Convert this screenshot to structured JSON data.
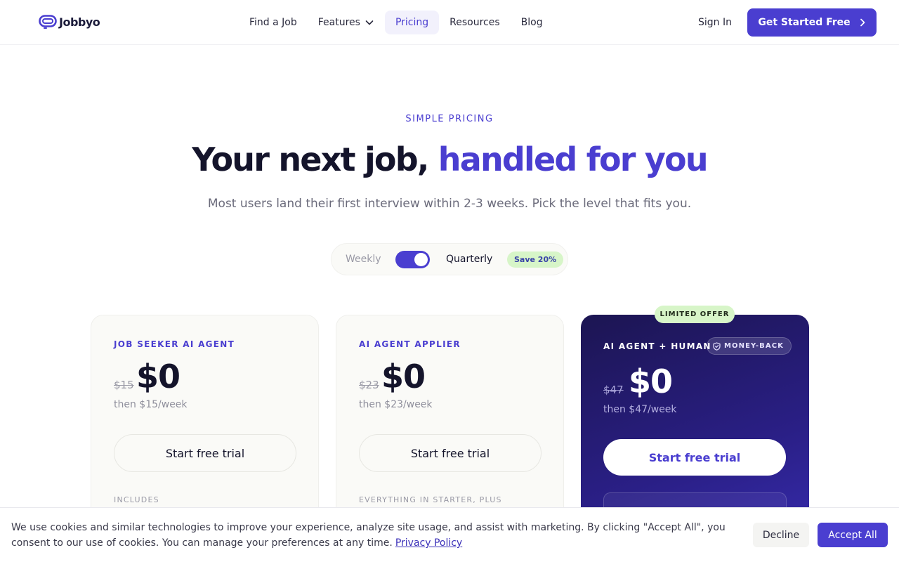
{
  "brand": {
    "name": "Jobbyo",
    "accent": "#4a3ed0"
  },
  "nav": {
    "items": [
      {
        "label": "Find a Job"
      },
      {
        "label": "Features"
      },
      {
        "label": "Pricing"
      },
      {
        "label": "Resources"
      },
      {
        "label": "Blog"
      }
    ],
    "active": "Pricing",
    "sign_in": "Sign In",
    "cta": "Get Started Free"
  },
  "hero": {
    "eyebrow": "SIMPLE PRICING",
    "title_main": "Your next job,",
    "title_accent": "handled for you",
    "subtitle": "Most users land their first interview within 2-3 weeks. Pick the level that fits you."
  },
  "billing": {
    "weekly": "Weekly",
    "quarterly": "Quarterly",
    "badge": "Save 20%",
    "selected": "Quarterly"
  },
  "plans": [
    {
      "title": "JOB SEEKER AI AGENT",
      "old_price": "$15",
      "price": "$0",
      "then": "then $15/week",
      "button": "Start free trial",
      "includes": "INCLUDES"
    },
    {
      "title": "AI AGENT APPLIER",
      "old_price": "$23",
      "price": "$0",
      "then": "then $23/week",
      "button": "Start free trial",
      "includes": "EVERYTHING IN STARTER, PLUS"
    },
    {
      "title": "AI AGENT + HUMAN",
      "badge": "MONEY-BACK",
      "ribbon": "LIMITED OFFER",
      "old_price": "$47",
      "price": "$0",
      "then": "then $47/week",
      "button": "Start free trial"
    }
  ],
  "cookie": {
    "text": "We use cookies and similar technologies to improve your experience, analyze site usage, and assist with marketing. By clicking \"Accept All\", you consent to our use of cookies. You can manage your preferences at any time.",
    "link": "Privacy Policy",
    "decline": "Decline",
    "accept": "Accept All"
  }
}
